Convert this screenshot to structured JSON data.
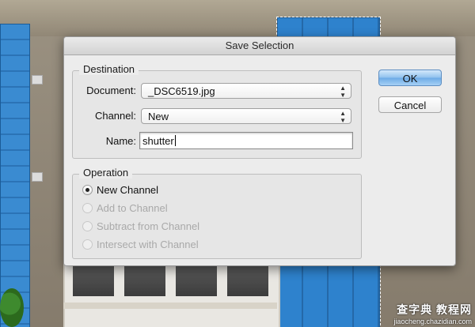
{
  "dialog": {
    "title": "Save Selection",
    "ok_label": "OK",
    "cancel_label": "Cancel"
  },
  "destination": {
    "title": "Destination",
    "document_label": "Document:",
    "document_value": "_DSC6519.jpg",
    "channel_label": "Channel:",
    "channel_value": "New",
    "name_label": "Name:",
    "name_value": "shutter"
  },
  "operation": {
    "title": "Operation",
    "options": [
      {
        "label": "New Channel",
        "selected": true,
        "enabled": true
      },
      {
        "label": "Add to Channel",
        "selected": false,
        "enabled": false
      },
      {
        "label": "Subtract from Channel",
        "selected": false,
        "enabled": false
      },
      {
        "label": "Intersect with Channel",
        "selected": false,
        "enabled": false
      }
    ]
  },
  "watermark": {
    "main": "查字典 教程网",
    "sub": "jiaocheng.chazidian.com"
  },
  "colors": {
    "accent_button": "#8fc1ee",
    "shutter_blue": "#2f7fc6"
  }
}
